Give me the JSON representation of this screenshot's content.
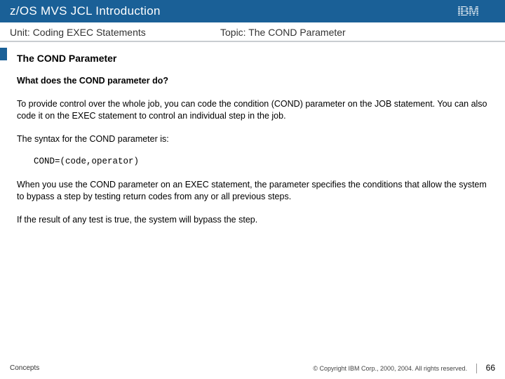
{
  "titlebar": {
    "text": "z/OS MVS JCL Introduction",
    "logo_name": "ibm-logo"
  },
  "meta": {
    "unit_label": "Unit:",
    "unit_value": "Coding EXEC Statements",
    "topic_label": "Topic:",
    "topic_value": "The COND Parameter"
  },
  "content": {
    "section_title": "The COND Parameter",
    "subquestion": "What does the COND parameter do?",
    "para1": "To provide control over the whole job, you can code the condition (COND) parameter on the JOB statement. You can also code it on the EXEC statement to control an individual step in the job.",
    "para2": "The syntax for the COND parameter is:",
    "code": "COND=(code,operator)",
    "para3": "When you use the COND parameter on an EXEC statement, the parameter specifies the conditions that allow the system to bypass a step by testing return codes from any or all previous steps.",
    "para4": "If the result of any test is true, the system will bypass the step."
  },
  "footer": {
    "left": "Concepts",
    "copyright": "© Copyright IBM Corp., 2000, 2004. All rights reserved.",
    "page_number": "66"
  }
}
